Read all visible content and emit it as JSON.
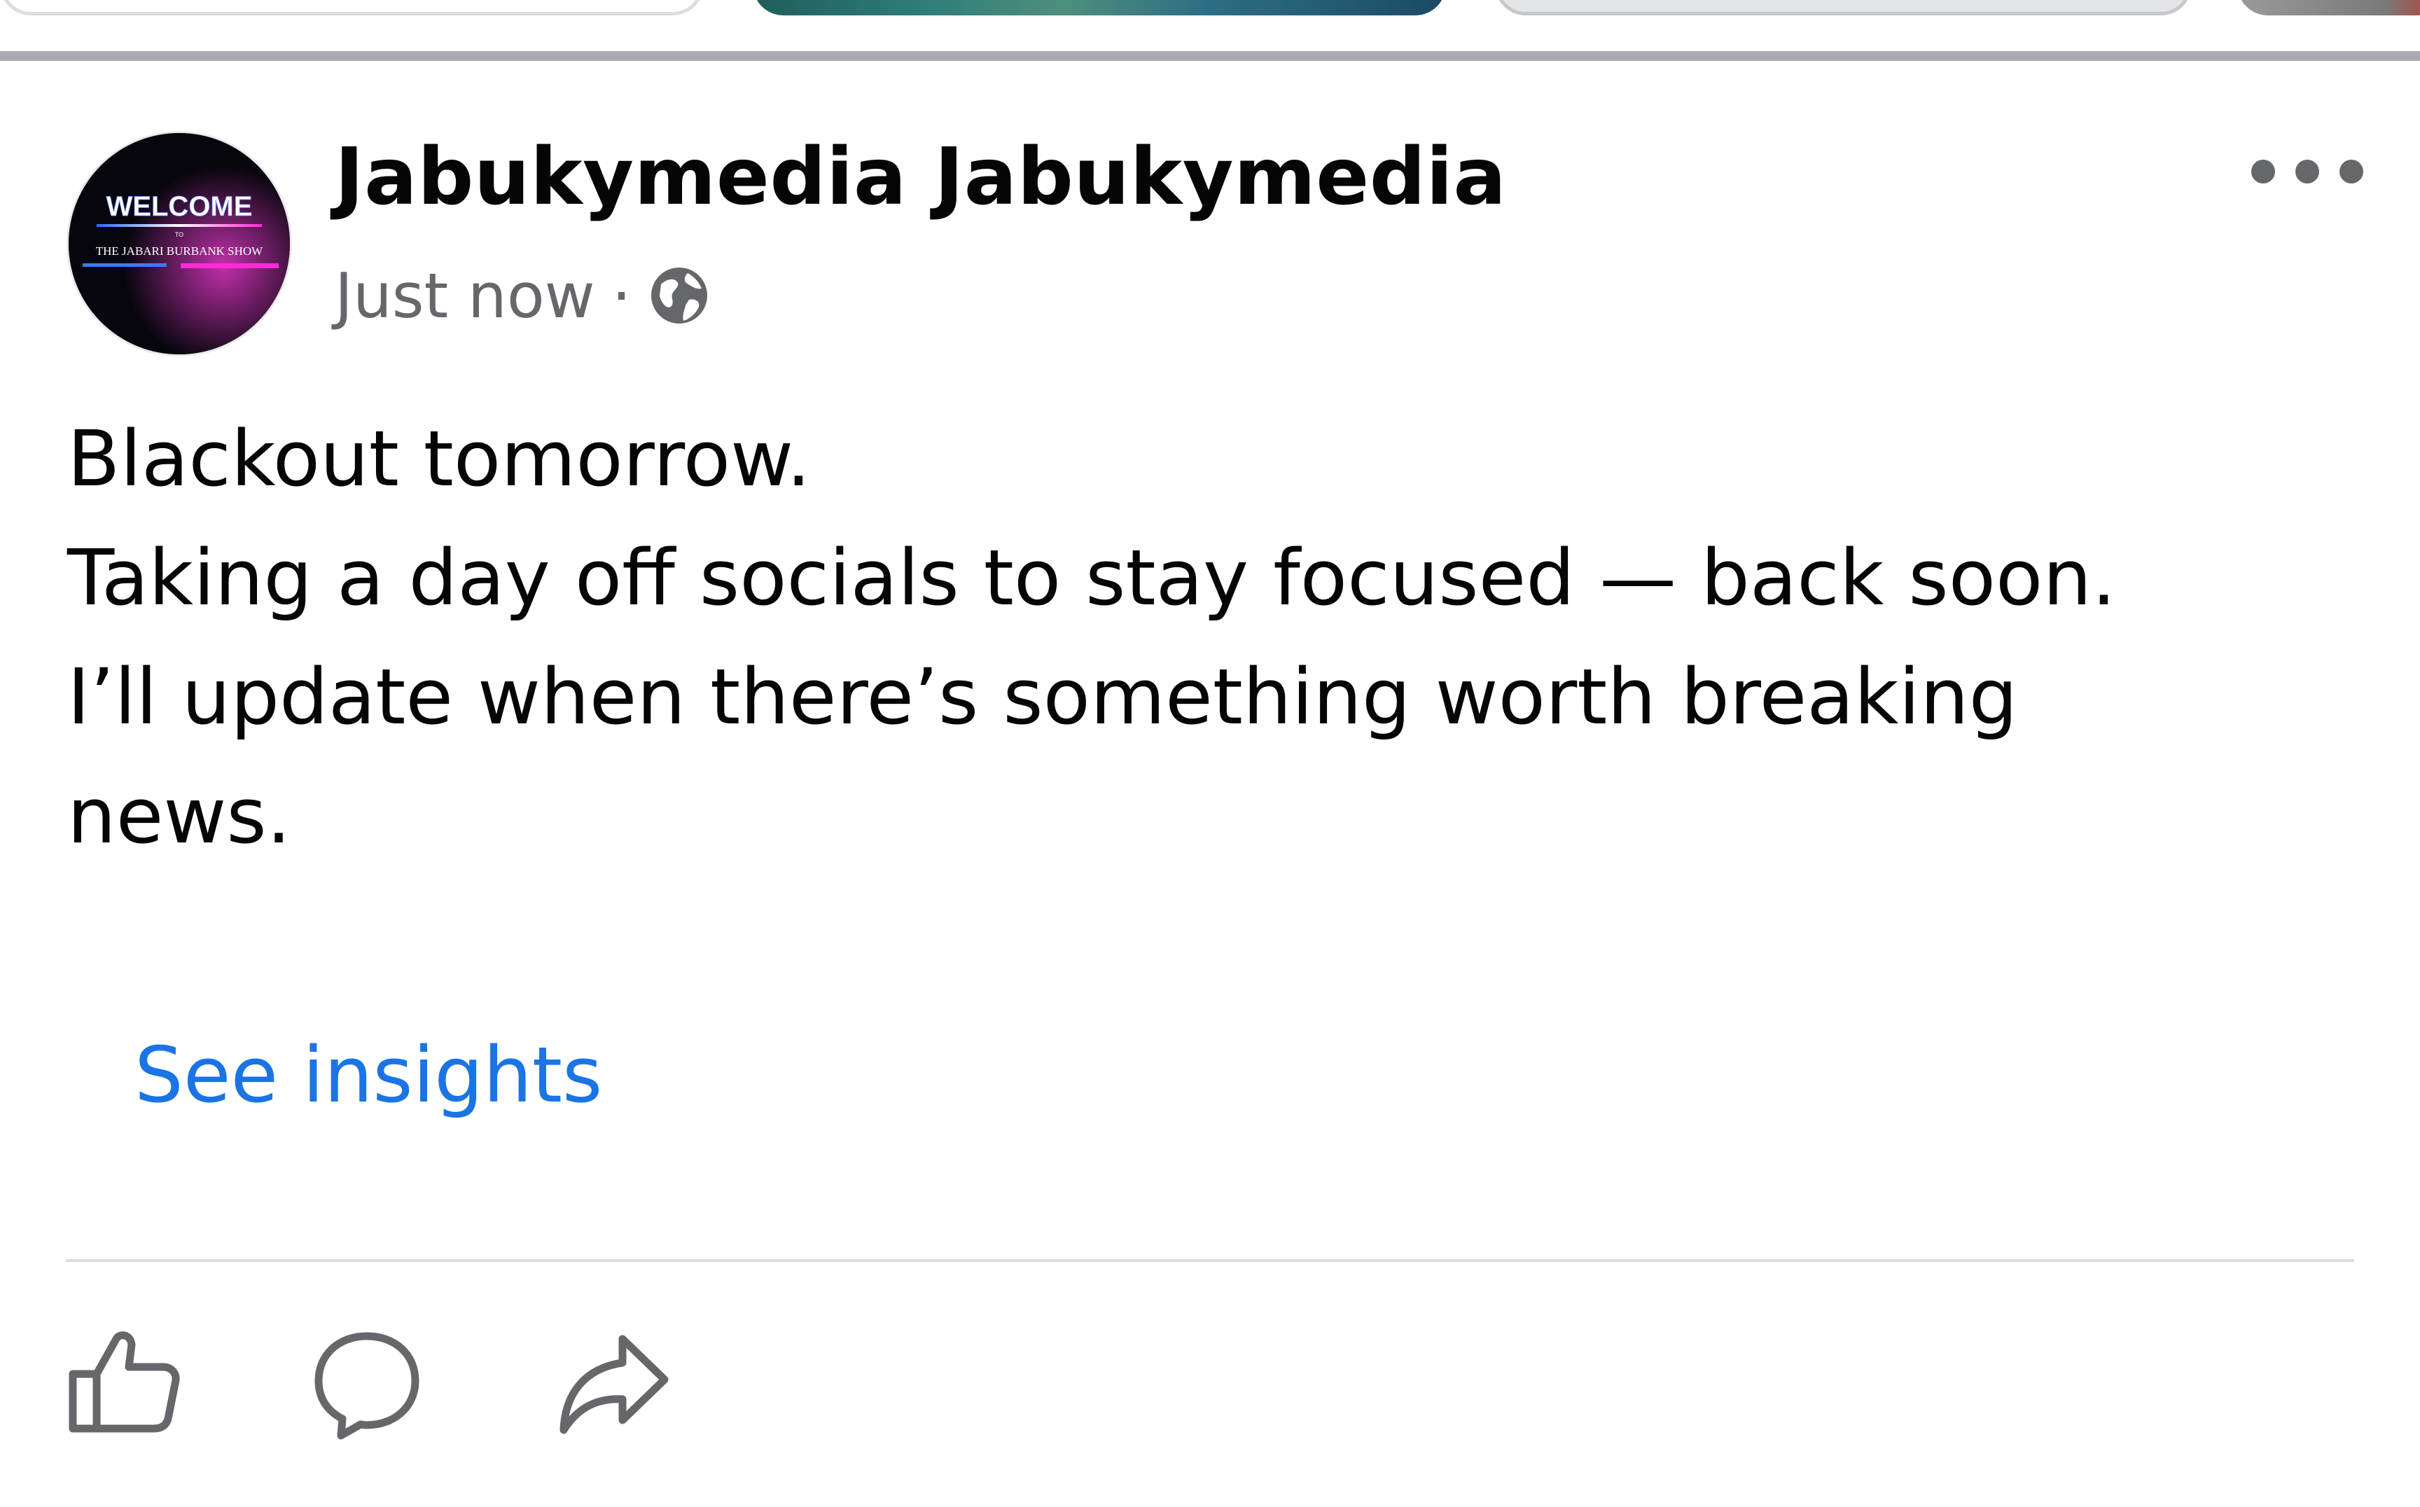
{
  "post": {
    "author": "Jabukymedia Jabukymedia",
    "timestamp": "Just now",
    "separator": "·",
    "audience_icon": "globe-icon",
    "more_icon": "more-horizontal-icon",
    "body_lines": [
      "Blackout tomorrow.",
      "Taking a day off socials to stay focused — back soon.",
      "I’ll update when there’s something worth breaking",
      "news."
    ],
    "insights_link": "See insights",
    "actions": [
      {
        "icon": "like-icon"
      },
      {
        "icon": "comment-icon"
      },
      {
        "icon": "share-icon"
      }
    ]
  },
  "avatar": {
    "line1": "WELCOME",
    "line2": "TO",
    "line3": "THE JABARI BURBANK SHOW"
  },
  "colors": {
    "link": "#1b74e4",
    "secondary_text": "#65676b",
    "primary_text": "#050505",
    "divider": "#dadde1"
  }
}
